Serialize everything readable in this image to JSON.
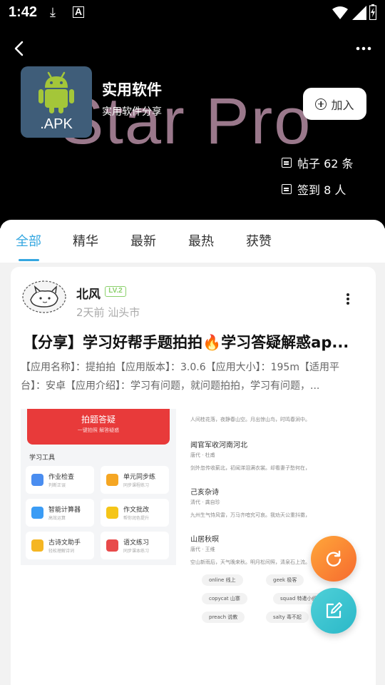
{
  "statusbar": {
    "time": "1:42"
  },
  "header": {
    "background_text": "Star Pro",
    "app_icon_label": ".APK",
    "title": "实用软件",
    "subtitle": "实用软件分享",
    "join_label": "加入",
    "posts_stat": "帖子 62 条",
    "signin_stat": "签到 8 人"
  },
  "tabs": [
    {
      "label": "全部",
      "active": true
    },
    {
      "label": "精华",
      "active": false
    },
    {
      "label": "最新",
      "active": false
    },
    {
      "label": "最热",
      "active": false
    },
    {
      "label": "获赞",
      "active": false
    }
  ],
  "post": {
    "author": "北风",
    "level_badge": "LV.2",
    "meta": "2天前 汕头市",
    "title": "【分享】学习好帮手题拍拍🔥学习答疑解惑ap...",
    "body": "【应用名称】：提拍拍【应用版本】：3.0.6【应用大小】：195m【适用平台】：安卓【应用介绍】：学习有问题，就问题拍拍，学习有问题，..."
  },
  "preview": {
    "banner_title": "拍题答疑",
    "banner_sub": "一键拍照 解答疑惑",
    "section_title": "学习工具",
    "tools": [
      {
        "title": "作业检查",
        "sub": "判断正误",
        "color": "#4a8df0"
      },
      {
        "title": "单元同步练",
        "sub": "同步课程练习",
        "color": "#f5a623"
      },
      {
        "title": "智能计算器",
        "sub": "高效运算",
        "color": "#3b9cf5"
      },
      {
        "title": "作文批改",
        "sub": "帮你润色提升",
        "color": "#f5c518"
      },
      {
        "title": "古诗文助手",
        "sub": "轻松理解诗词",
        "color": "#f5b623"
      },
      {
        "title": "语文练习",
        "sub": "同步课本练习",
        "color": "#e84a4a"
      }
    ],
    "right_lines": [
      "人间桂花落，夜静春山空。月出惊山鸟，时鸣春涧中。",
      "闻官军收河南河北",
      "唐代 · 杜甫",
      "剑外忽传收蓟北，初闻涕泪满衣裳。却看妻子愁何在，",
      "己亥杂诗",
      "清代 · 龚自珍",
      "九州生气恃风雷，万马齐喑究可哀。我劝天公重抖擞，",
      "山居秋暝",
      "唐代 · 王维",
      "空山新雨后，天气晚来秋。明月松间照，清泉石上流。"
    ],
    "chips": [
      "online 线上",
      "geek 极客",
      "copycat 山寨",
      "squad 特遣小组",
      "preach 说教",
      "salty 毒不起"
    ]
  },
  "colors": {
    "accent": "#35a7e0",
    "level_green": "#8bd06b",
    "fab_orange": "#f88a30",
    "fab_teal": "#3cc4d0"
  }
}
